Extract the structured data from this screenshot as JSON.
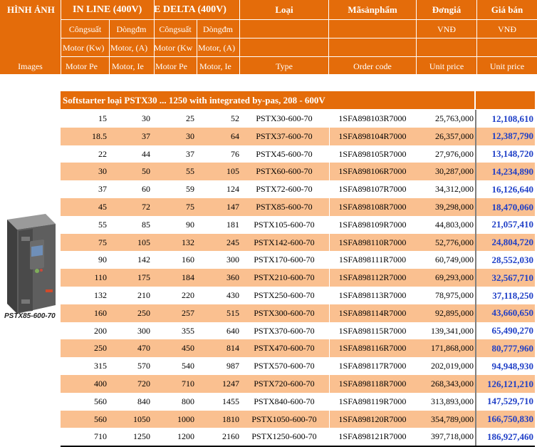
{
  "header": {
    "row1": {
      "images": "HÌNH ẢNH",
      "in_line": "IN LINE (400V)",
      "delta": "E DELTA (400V)",
      "type": "Loại",
      "code": "Mãsảnphẩm",
      "unit_price": "Đơngiá",
      "sale_price": "Giá bán"
    },
    "row2": {
      "power1": "Côngsuất",
      "current1": "Dòngđm",
      "power2": "Côngsuất",
      "current2": "Dòngđm"
    },
    "row2_currency": {
      "unit": "VNĐ",
      "sale": "VNĐ"
    },
    "row3": {
      "c1": "Motor (Kw)",
      "c2": "Motor, (A)",
      "c3": "Motor (Kw",
      "c4": "Motor, (A)"
    },
    "row4": {
      "images": "Images",
      "c1": "Motor Pe",
      "c2": "Motor, Ie",
      "c3": "Motor Pe",
      "c4": "Motor, Ie",
      "type": "Type",
      "code": "Order code",
      "unit_price": "Unit price",
      "sale_price": "Unit price"
    }
  },
  "section_title": "Softstarter loại PSTX30 ... 1250 with integrated by-pas, 208 - 600V",
  "product_caption": "PSTX85-600-70",
  "rows": [
    {
      "pe": "15",
      "ie": "30",
      "pe2": "25",
      "ie2": "52",
      "type": "PSTX30-600-70",
      "code": "1SFA898103R7000",
      "unit": "25,763,000",
      "sale": "12,108,610"
    },
    {
      "pe": "18.5",
      "ie": "37",
      "pe2": "30",
      "ie2": "64",
      "type": "PSTX37-600-70",
      "code": "1SFA898104R7000",
      "unit": "26,357,000",
      "sale": "12,387,790"
    },
    {
      "pe": "22",
      "ie": "44",
      "pe2": "37",
      "ie2": "76",
      "type": "PSTX45-600-70",
      "code": "1SFA898105R7000",
      "unit": "27,976,000",
      "sale": "13,148,720"
    },
    {
      "pe": "30",
      "ie": "50",
      "pe2": "55",
      "ie2": "105",
      "type": "PSTX60-600-70",
      "code": "1SFA898106R7000",
      "unit": "30,287,000",
      "sale": "14,234,890"
    },
    {
      "pe": "37",
      "ie": "60",
      "pe2": "59",
      "ie2": "124",
      "type": "PSTX72-600-70",
      "code": "1SFA898107R7000",
      "unit": "34,312,000",
      "sale": "16,126,640"
    },
    {
      "pe": "45",
      "ie": "72",
      "pe2": "75",
      "ie2": "147",
      "type": "PSTX85-600-70",
      "code": "1SFA898108R7000",
      "unit": "39,298,000",
      "sale": "18,470,060"
    },
    {
      "pe": "55",
      "ie": "85",
      "pe2": "90",
      "ie2": "181",
      "type": "PSTX105-600-70",
      "code": "1SFA898109R7000",
      "unit": "44,803,000",
      "sale": "21,057,410"
    },
    {
      "pe": "75",
      "ie": "105",
      "pe2": "132",
      "ie2": "245",
      "type": "PSTX142-600-70",
      "code": "1SFA898110R7000",
      "unit": "52,776,000",
      "sale": "24,804,720"
    },
    {
      "pe": "90",
      "ie": "142",
      "pe2": "160",
      "ie2": "300",
      "type": "PSTX170-600-70",
      "code": "1SFA898111R7000",
      "unit": "60,749,000",
      "sale": "28,552,030"
    },
    {
      "pe": "110",
      "ie": "175",
      "pe2": "184",
      "ie2": "360",
      "type": "PSTX210-600-70",
      "code": "1SFA898112R7000",
      "unit": "69,293,000",
      "sale": "32,567,710"
    },
    {
      "pe": "132",
      "ie": "210",
      "pe2": "220",
      "ie2": "430",
      "type": "PSTX250-600-70",
      "code": "1SFA898113R7000",
      "unit": "78,975,000",
      "sale": "37,118,250"
    },
    {
      "pe": "160",
      "ie": "250",
      "pe2": "257",
      "ie2": "515",
      "type": "PSTX300-600-70",
      "code": "1SFA898114R7000",
      "unit": "92,895,000",
      "sale": "43,660,650"
    },
    {
      "pe": "200",
      "ie": "300",
      "pe2": "355",
      "ie2": "640",
      "type": "PSTX370-600-70",
      "code": "1SFA898115R7000",
      "unit": "139,341,000",
      "sale": "65,490,270"
    },
    {
      "pe": "250",
      "ie": "470",
      "pe2": "450",
      "ie2": "814",
      "type": "PSTX470-600-70",
      "code": "1SFA898116R7000",
      "unit": "171,868,000",
      "sale": "80,777,960"
    },
    {
      "pe": "315",
      "ie": "570",
      "pe2": "540",
      "ie2": "987",
      "type": "PSTX570-600-70",
      "code": "1SFA898117R7000",
      "unit": "202,019,000",
      "sale": "94,948,930"
    },
    {
      "pe": "400",
      "ie": "720",
      "pe2": "710",
      "ie2": "1247",
      "type": "PSTX720-600-70",
      "code": "1SFA898118R7000",
      "unit": "268,343,000",
      "sale": "126,121,210"
    },
    {
      "pe": "560",
      "ie": "840",
      "pe2": "800",
      "ie2": "1455",
      "type": "PSTX840-600-70",
      "code": "1SFA898119R7000",
      "unit": "313,893,000",
      "sale": "147,529,710"
    },
    {
      "pe": "560",
      "ie": "1050",
      "pe2": "1000",
      "ie2": "1810",
      "type": "PSTX1050-600-70",
      "code": "1SFA898120R7000",
      "unit": "354,789,000",
      "sale": "166,750,830"
    },
    {
      "pe": "710",
      "ie": "1250",
      "pe2": "1200",
      "ie2": "2160",
      "type": "PSTX1250-600-70",
      "code": "1SFA898121R7000",
      "unit": "397,718,000",
      "sale": "186,927,460"
    }
  ],
  "colors": {
    "header_orange": "#e46c0a",
    "row_orange": "#fac090",
    "price_blue": "#1f3fc7"
  },
  "icons": {
    "product": "softstarter-device-image"
  }
}
